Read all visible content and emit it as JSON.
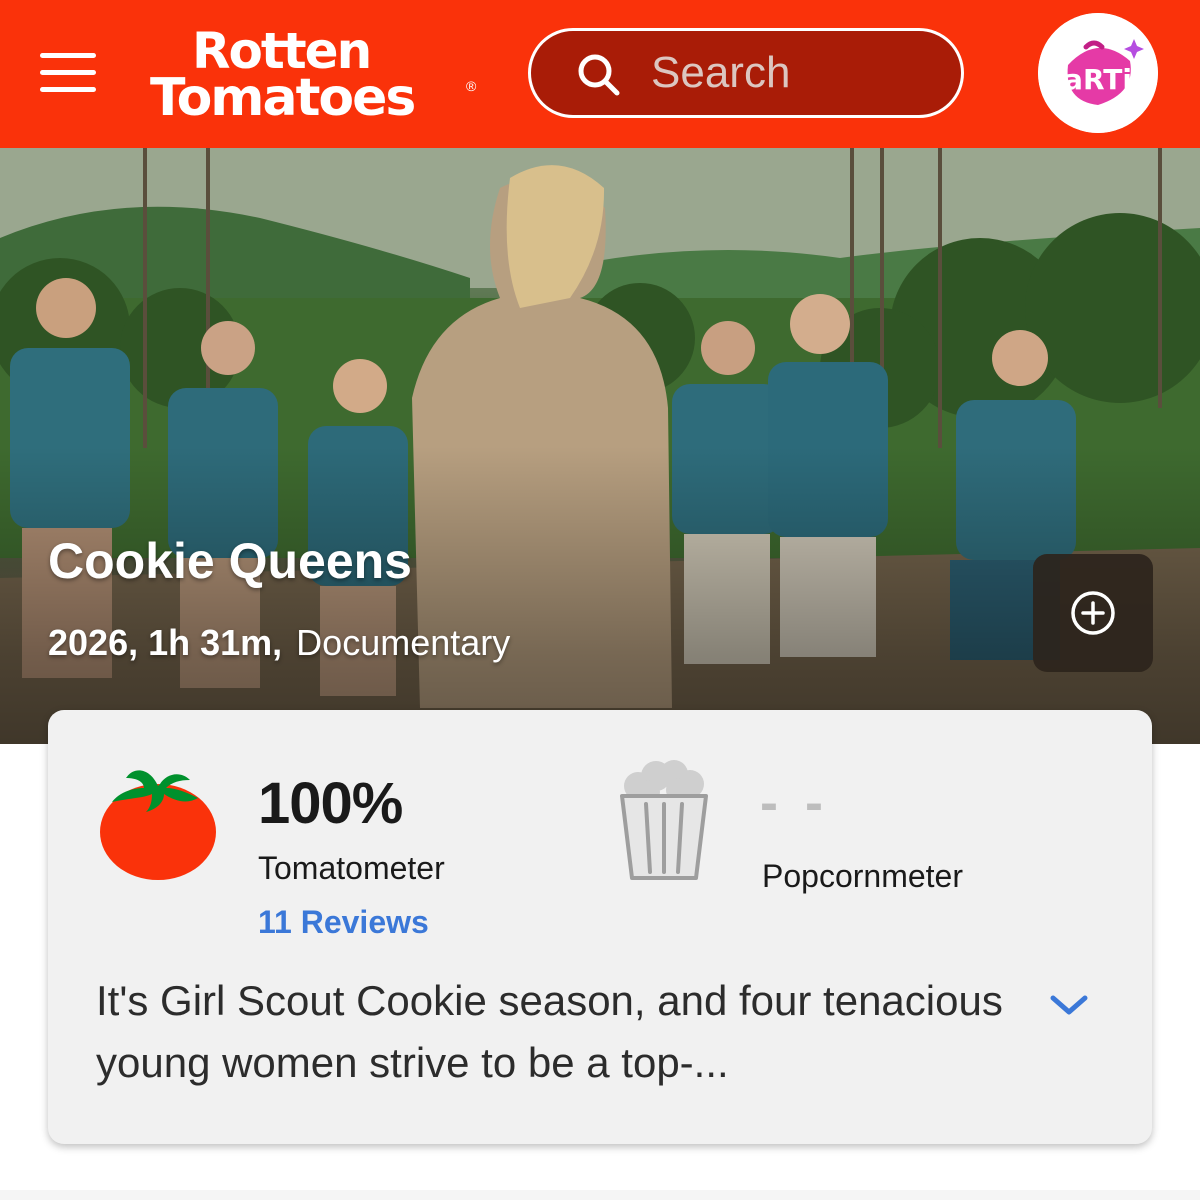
{
  "header": {
    "menu_icon": "hamburger-menu-icon",
    "logo": {
      "line1": "Rotten",
      "line2": "Tomatoes",
      "reg": "®"
    },
    "search": {
      "placeholder": "Search",
      "value": ""
    },
    "avatar": {
      "text": "aRTi"
    },
    "brand_color": "#fa320a"
  },
  "hero": {
    "title": "Cookie Queens",
    "year_runtime": "2026, 1h 31m,",
    "genre": "Documentary",
    "add_icon": "plus-circle-icon"
  },
  "scores": {
    "tomatometer": {
      "value": "100%",
      "label": "Tomatometer",
      "reviews": "11 Reviews",
      "icon": "fresh-tomato-icon"
    },
    "popcornmeter": {
      "value": "- -",
      "label": "Popcornmeter",
      "icon": "popcorn-bucket-icon"
    }
  },
  "synopsis": {
    "text": "It's Girl Scout Cookie season, and four tenacious young women strive to be a top-...",
    "expand_icon": "chevron-down-icon"
  },
  "colors": {
    "link": "#3b78d8",
    "card_bg": "#f1f1f1"
  }
}
